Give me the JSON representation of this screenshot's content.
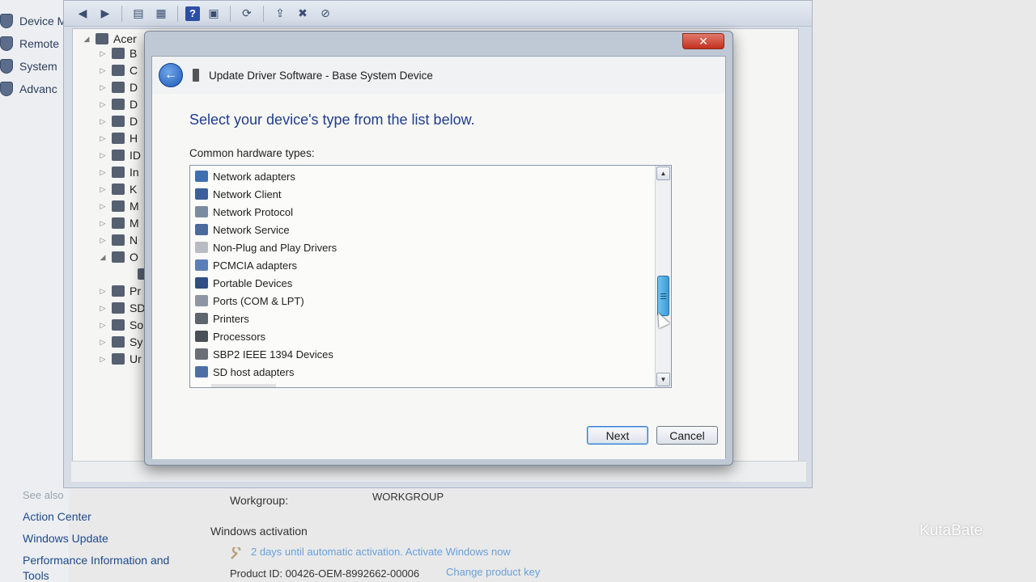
{
  "control_panel": {
    "left_links": [
      "Device M",
      "Remote",
      "System",
      "Advanc"
    ],
    "see_also": "See also",
    "bottom_links": [
      "Action Center",
      "Windows Update",
      "Performance Information and",
      "Tools"
    ],
    "workgroup_label": "Workgroup:",
    "workgroup_value": "WORKGROUP",
    "activation_label": "Windows activation",
    "activation_text": "2 days until automatic activation. Activate Windows now",
    "product_id": "Product ID: 00426-OEM-8992662-00006",
    "change_key": "Change product key"
  },
  "device_manager": {
    "root": "Acer",
    "tree_items": [
      "B",
      "C",
      "D",
      "D",
      "D",
      "H",
      "ID",
      "In",
      "K",
      "M",
      "M",
      "N",
      "O",
      "",
      "Pr",
      "SD",
      "So",
      "Sy",
      "Ur"
    ]
  },
  "dialog": {
    "title": "Update Driver Software - Base System Device",
    "close_glyph": "✕",
    "heading": "Select your device's type from the list below.",
    "list_label": "Common hardware types:",
    "items": [
      {
        "label": "Network adapters",
        "icon": "network-adapter-icon",
        "color": "#3e6fb0"
      },
      {
        "label": "Network Client",
        "icon": "network-client-icon",
        "color": "#3b5f9a"
      },
      {
        "label": "Network Protocol",
        "icon": "network-protocol-icon",
        "color": "#7a8c9f"
      },
      {
        "label": "Network Service",
        "icon": "network-service-icon",
        "color": "#4a6a9e"
      },
      {
        "label": "Non-Plug and Play Drivers",
        "icon": "non-pnp-icon",
        "color": "#b8bcc2"
      },
      {
        "label": "PCMCIA adapters",
        "icon": "pcmcia-icon",
        "color": "#5a7fb8"
      },
      {
        "label": "Portable Devices",
        "icon": "portable-device-icon",
        "color": "#2f4f86"
      },
      {
        "label": "Ports (COM & LPT)",
        "icon": "ports-icon",
        "color": "#8d96a2"
      },
      {
        "label": "Printers",
        "icon": "printer-icon",
        "color": "#5f656e"
      },
      {
        "label": "Processors",
        "icon": "processor-icon",
        "color": "#4b5058"
      },
      {
        "label": "SBP2 IEEE 1394 Devices",
        "icon": "sbp2-icon",
        "color": "#6b6f75"
      },
      {
        "label": "SD host adapters",
        "icon": "sd-host-icon",
        "color": "#4c6fa8"
      }
    ],
    "next_label": "Next",
    "cancel_label": "Cancel"
  },
  "watermark": "KutaBate",
  "scroll_position": 0.63
}
